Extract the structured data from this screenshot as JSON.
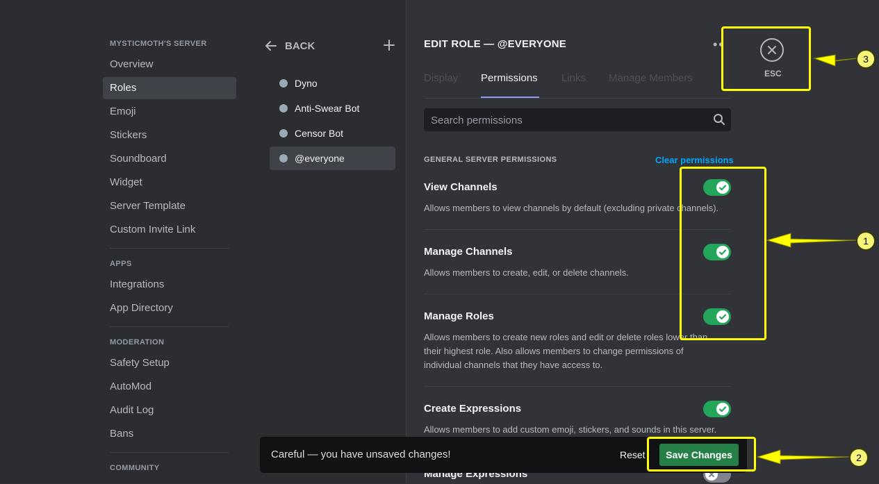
{
  "sidebar": {
    "server_header": "MYSTICMOTH'S SERVER",
    "server_items": [
      "Overview",
      "Roles",
      "Emoji",
      "Stickers",
      "Soundboard",
      "Widget",
      "Server Template",
      "Custom Invite Link"
    ],
    "apps_header": "APPS",
    "apps_items": [
      "Integrations",
      "App Directory"
    ],
    "moderation_header": "MODERATION",
    "moderation_items": [
      "Safety Setup",
      "AutoMod",
      "Audit Log",
      "Bans"
    ],
    "community_header": "COMMUNITY",
    "active_item": "Roles"
  },
  "roles_panel": {
    "back_label": "BACK",
    "roles": [
      "Dyno",
      "Anti-Swear Bot",
      "Censor Bot",
      "@everyone"
    ],
    "active_role": "@everyone",
    "role_color": "#99aab5"
  },
  "main": {
    "title": "EDIT ROLE — @EVERYONE",
    "tabs": [
      "Display",
      "Permissions",
      "Links",
      "Manage Members"
    ],
    "active_tab": "Permissions",
    "search_placeholder": "Search permissions",
    "section_header": "GENERAL SERVER PERMISSIONS",
    "clear_label": "Clear permissions",
    "permissions": [
      {
        "name": "View Channels",
        "desc": "Allows members to view channels by default (excluding private channels).",
        "enabled": true
      },
      {
        "name": "Manage Channels",
        "desc": "Allows members to create, edit, or delete channels.",
        "enabled": true
      },
      {
        "name": "Manage Roles",
        "desc": "Allows members to create new roles and edit or delete roles lower than their highest role. Also allows members to change permissions of individual channels that they have access to.",
        "enabled": true
      },
      {
        "name": "Create Expressions",
        "desc": "Allows members to add custom emoji, stickers, and sounds in this server.",
        "enabled": true
      },
      {
        "name": "Manage Expressions",
        "desc": "",
        "enabled": false
      }
    ]
  },
  "esc": {
    "label": "ESC"
  },
  "unsaved_bar": {
    "message": "Careful — you have unsaved changes!",
    "reset_label": "Reset",
    "save_label": "Save Changes"
  },
  "annotations": {
    "badges": [
      "1",
      "2",
      "3"
    ],
    "color": "#ffff00"
  },
  "colors": {
    "accent": "#949cf7",
    "toggle_on": "#23a55a",
    "save": "#248046",
    "link": "#00a8fc"
  }
}
